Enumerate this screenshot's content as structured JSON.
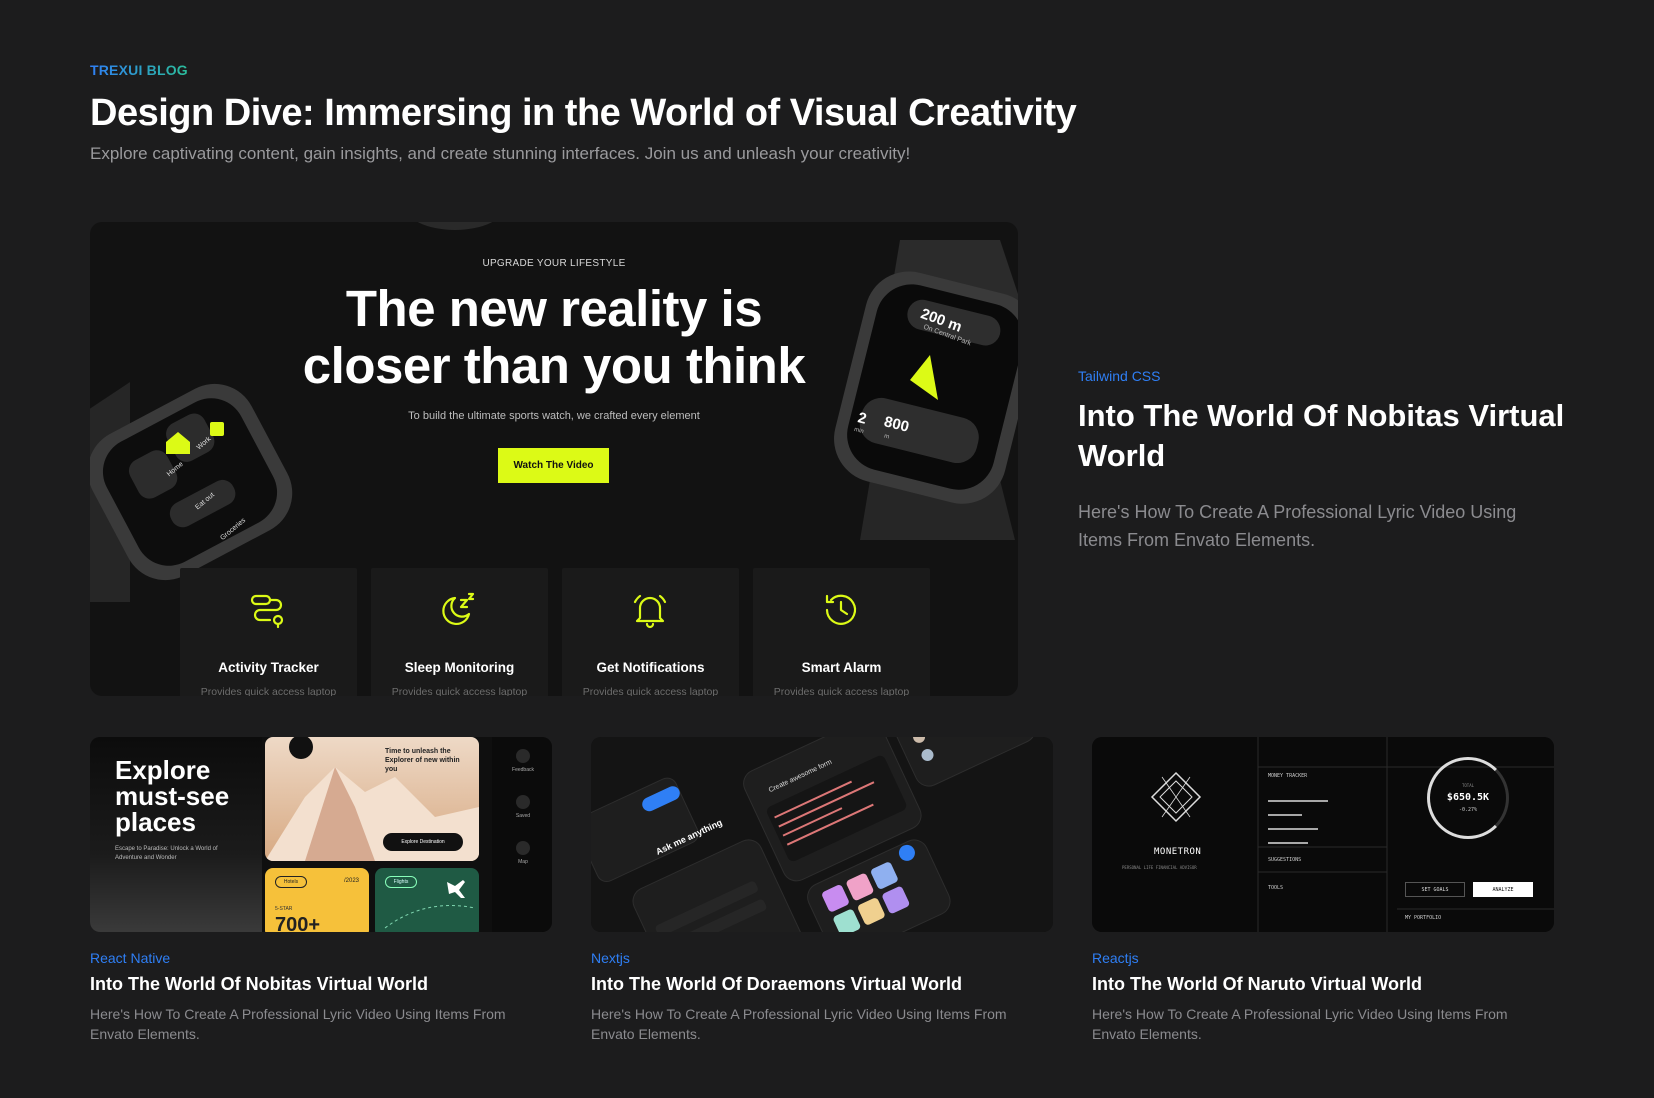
{
  "header": {
    "eyebrow": "TREXUI BLOG",
    "title": "Design Dive: Immersing in the World of Visual Creativity",
    "subtitle": "Explore captivating content, gain insights, and create stunning interfaces. Join us and unleash your creativity!"
  },
  "featured": {
    "image": {
      "tagline": "UPGRADE YOUR LIFESTYLE",
      "headline_line1": "The new reality is",
      "headline_line2": "closer than you think",
      "subline": "To build the ultimate sports watch, we crafted every element",
      "cta": "Watch The Video",
      "watch_right_distance": "200 m",
      "watch_right_place": "On Central Park",
      "watch_right_min": "2",
      "watch_right_min_unit": "min",
      "watch_right_m": "800",
      "watch_right_m_unit": "m",
      "watch_left_items": [
        "Home",
        "Work",
        "Eat out",
        "Groceries"
      ],
      "features": [
        {
          "title": "Activity Tracker",
          "icon": "route-icon",
          "desc": "Provides quick access laptop"
        },
        {
          "title": "Sleep Monitoring",
          "icon": "moon-zzz-icon",
          "desc": "Provides quick access laptop"
        },
        {
          "title": "Get Notifications",
          "icon": "bell-icon",
          "desc": "Provides quick access laptop"
        },
        {
          "title": "Smart Alarm",
          "icon": "clock-history-icon",
          "desc": "Provides quick access laptop"
        }
      ]
    },
    "category": "Tailwind CSS",
    "title": "Into The World Of Nobitas Virtual World",
    "excerpt": "Here's How To Create A Professional Lyric Video Using Items From Envato Elements."
  },
  "cards": [
    {
      "category": "React Native",
      "title": "Into The World Of Nobitas Virtual World",
      "excerpt": "Here's How To Create A Professional Lyric Video Using Items From Envato Elements.",
      "thumb": {
        "headline": "Explore must-see places",
        "body": "Escape to Paradise: Unlock a World of Adventure and Wonder",
        "promo": "Time to unleash the Explorer of new within you",
        "promo_button": "Explore Destination",
        "hotels_label": "Hotels",
        "hotels_date": "/2023",
        "hotels_small": "5-STAR",
        "hotels_big": "700+",
        "flights_label": "Flights",
        "rail": [
          "Feedback",
          "Saved",
          "Map"
        ]
      }
    },
    {
      "category": "Nextjs",
      "title": "Into The World Of Doraemons Virtual World",
      "excerpt": "Here's How To Create A Professional Lyric Video Using Items From Envato Elements.",
      "thumb": {
        "ask": "Ask me anything",
        "create": "Create awesome form"
      }
    },
    {
      "category": "Reactjs",
      "title": "Into The World Of Naruto Virtual World",
      "excerpt": "Here's How To Create A Professional Lyric Video Using Items From Envato Elements.",
      "thumb": {
        "brand": "MONETRON",
        "brand_sub": "PERSONAL LIFE FINANCIAL ADVISOR",
        "money_tracker": "MONEY TRACKER",
        "suggestions": "SUGGESTIONS",
        "tools": "TOOLS",
        "total_label": "TOTAL",
        "total_value": "$650.5K",
        "total_delta": "-0.27%",
        "btn_left": "SET GOALS",
        "btn_right": "ANALYZE",
        "portfolio": "MY PORTFOLIO"
      }
    }
  ],
  "colors": {
    "background": "#1c1c1d",
    "accent_blue": "#2f7ff5",
    "accent_lime": "#dcfa16"
  }
}
